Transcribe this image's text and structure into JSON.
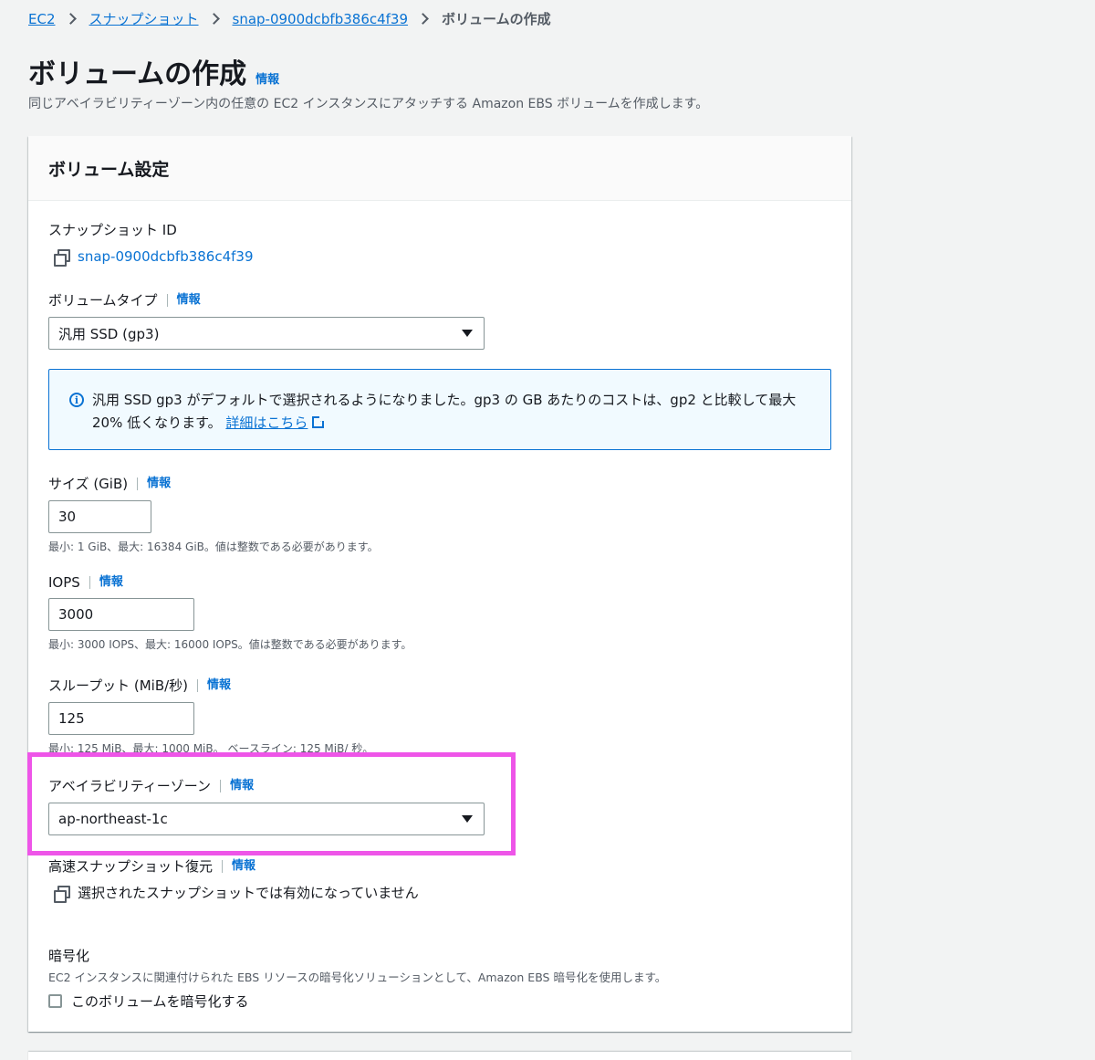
{
  "breadcrumb": {
    "items": [
      "EC2",
      "スナップショット",
      "snap-0900dcbfb386c4f39"
    ],
    "current": "ボリュームの作成"
  },
  "page": {
    "title": "ボリュームの作成",
    "info_label": "情報",
    "description": "同じアベイラビリティーゾーン内の任意の EC2 インスタンスにアタッチする Amazon EBS ボリュームを作成します。"
  },
  "panel": {
    "title": "ボリューム設定"
  },
  "snapshot": {
    "label": "スナップショット ID",
    "value": "snap-0900dcbfb386c4f39"
  },
  "volume_type": {
    "label": "ボリュームタイプ",
    "info": "情報",
    "selected": "汎用 SSD (gp3)"
  },
  "alert": {
    "text": "汎用 SSD gp3 がデフォルトで選択されるようになりました。gp3 の GB あたりのコストは、gp2 と比較して最大 20% 低くなります。",
    "link": "詳細はこちら"
  },
  "size": {
    "label": "サイズ (GiB)",
    "info": "情報",
    "value": "30",
    "hint": "最小: 1 GiB、最大: 16384 GiB。値は整数である必要があります。"
  },
  "iops": {
    "label": "IOPS",
    "info": "情報",
    "value": "3000",
    "hint": "最小: 3000 IOPS、最大: 16000 IOPS。値は整数である必要があります。"
  },
  "throughput": {
    "label": "スループット (MiB/秒)",
    "info": "情報",
    "value": "125",
    "hint": "最小: 125 MiB、最大: 1000 MiB。 ベースライン: 125 MiB/ 秒。"
  },
  "az": {
    "label": "アベイラビリティーゾーン",
    "info": "情報",
    "selected": "ap-northeast-1c"
  },
  "fsr": {
    "label": "高速スナップショット復元",
    "info": "情報",
    "value": "選択されたスナップショットでは有効になっていません"
  },
  "encryption": {
    "label": "暗号化",
    "description": "EC2 インスタンスに関連付けられた EBS リソースの暗号化ソリューションとして、Amazon EBS 暗号化を使用します。",
    "checkbox_label": "このボリュームを暗号化する"
  },
  "colors": {
    "link": "#0972d3",
    "highlight": "#ee55e8",
    "alert_bg": "#f1faff"
  }
}
